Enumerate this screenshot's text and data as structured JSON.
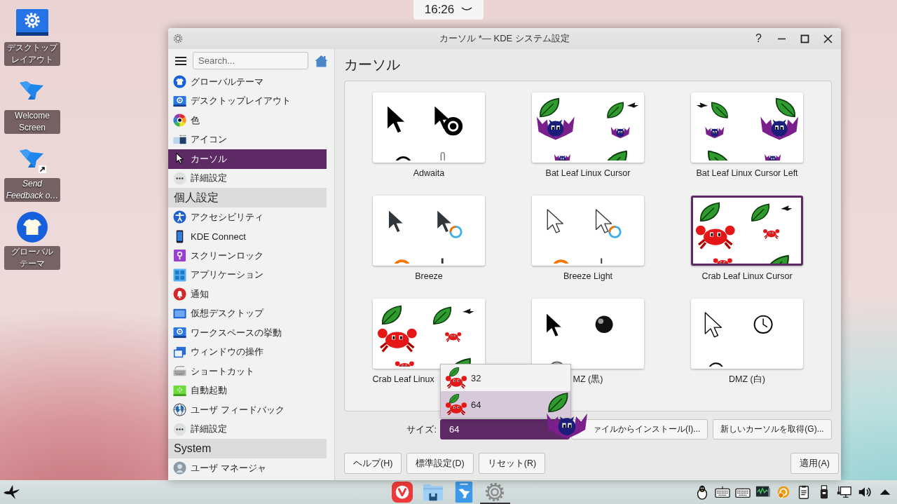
{
  "desktop": {
    "clock": "16:26",
    "icons": [
      {
        "label": "デスクトップレイアウト",
        "link": false
      },
      {
        "label": "Welcome Screen",
        "link": false
      },
      {
        "label": "Send Feedback o…",
        "link": true
      },
      {
        "label": "グローバルテーマ",
        "link": false
      }
    ]
  },
  "window": {
    "title": "カーソル *— KDE システム設定",
    "help": "?"
  },
  "sidebar": {
    "search": {
      "placeholder": "Search..."
    },
    "groups": [
      {
        "items": [
          {
            "label": "グローバルテーマ",
            "selected": false
          },
          {
            "label": "デスクトップレイアウト",
            "selected": false
          },
          {
            "label": "色",
            "selected": false
          },
          {
            "label": "アイコン",
            "selected": false
          },
          {
            "label": "カーソル",
            "selected": true
          },
          {
            "label": "詳細設定",
            "selected": false
          }
        ]
      },
      {
        "header": "個人設定",
        "items": [
          {
            "label": "アクセシビリティ",
            "selected": false
          },
          {
            "label": "KDE Connect",
            "selected": false
          },
          {
            "label": "スクリーンロック",
            "selected": false
          },
          {
            "label": "アプリケーション",
            "selected": false
          },
          {
            "label": "通知",
            "selected": false
          },
          {
            "label": "仮想デスクトップ",
            "selected": false
          },
          {
            "label": "ワークスペースの挙動",
            "selected": false
          },
          {
            "label": "ウィンドウの操作",
            "selected": false
          },
          {
            "label": "ショートカット",
            "selected": false
          },
          {
            "label": "自動起動",
            "selected": false
          },
          {
            "label": "ユーザ フィードバック",
            "selected": false
          },
          {
            "label": "詳細設定",
            "selected": false
          }
        ]
      },
      {
        "header": "System",
        "items": [
          {
            "label": "ユーザ マネージャ",
            "selected": false
          }
        ]
      }
    ]
  },
  "page": {
    "heading": "カーソル",
    "themes": [
      {
        "label": "Adwaita",
        "selected": false
      },
      {
        "label": "Bat Leaf Linux Cursor",
        "selected": false
      },
      {
        "label": "Bat Leaf Linux Cursor Left",
        "selected": false
      },
      {
        "label": "Breeze",
        "selected": false
      },
      {
        "label": "Breeze Light",
        "selected": false
      },
      {
        "label": "Crab Leaf Linux Cursor",
        "selected": true
      },
      {
        "label": "Crab Leaf Linux",
        "selected": false,
        "covered": true
      },
      {
        "label": "MZ (黒)",
        "selected": false
      },
      {
        "label": "DMZ (白)",
        "selected": false
      }
    ],
    "size": {
      "label": "サイズ:",
      "value": "64",
      "expanded": true,
      "options": [
        {
          "label": "32",
          "selected": false
        },
        {
          "label": "64",
          "selected": true
        }
      ]
    },
    "actions": [
      "ァイルからインストール(I)...",
      "新しいカーソルを取得(G)..."
    ],
    "footer": {
      "left": [
        "ヘルプ(H)",
        "標準設定(D)",
        "リセット(R)"
      ],
      "right": [
        "適用(A)"
      ]
    }
  },
  "taskbar": {
    "tasks": [
      {
        "active": false
      },
      {
        "active": false
      },
      {
        "active": false
      },
      {
        "active": true
      }
    ]
  }
}
